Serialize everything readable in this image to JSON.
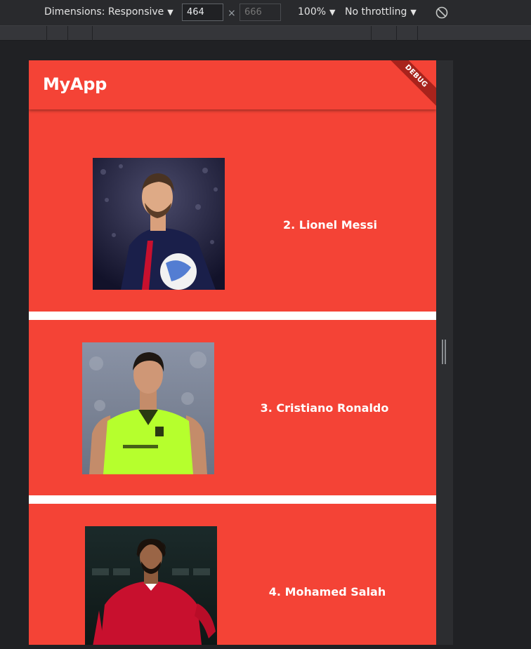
{
  "devtools": {
    "dimensions_label": "Dimensions: Responsive",
    "width_value": "464",
    "height_placeholder": "666",
    "times_symbol": "×",
    "zoom_label": "100%",
    "throttling_label": "No throttling",
    "caret": "▼"
  },
  "app": {
    "title": "MyApp",
    "debug_banner": "DEBUG",
    "accent_color": "#f44336"
  },
  "players": [
    {
      "name": "2. Lionel Messi",
      "photo_icon": "messi-photo"
    },
    {
      "name": "3. Cristiano Ronaldo",
      "photo_icon": "ronaldo-photo"
    },
    {
      "name": "4. Mohamed Salah",
      "photo_icon": "salah-photo"
    }
  ]
}
